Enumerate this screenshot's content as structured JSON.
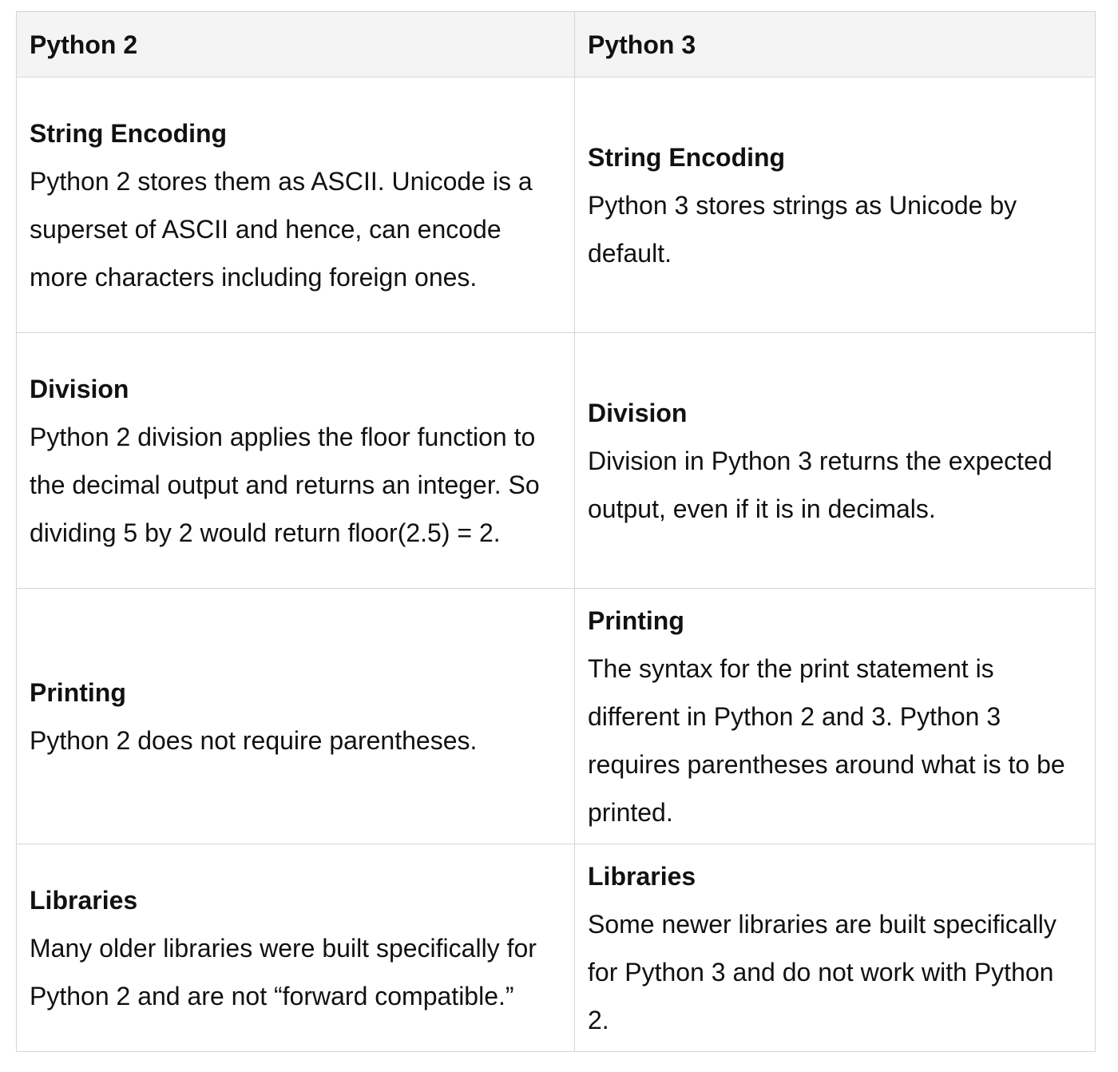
{
  "table": {
    "headers": [
      "Python 2",
      "Python 3"
    ],
    "rows": [
      {
        "python2": {
          "title": "String Encoding",
          "body": "Python 2 stores them as ASCII. Unicode is a superset of ASCII and hence, can encode more characters including foreign ones."
        },
        "python3": {
          "title": "String Encoding",
          "body": "Python 3 stores strings as Unicode by default."
        }
      },
      {
        "python2": {
          "title": "Division",
          "body": "Python 2 division applies the floor function to the decimal output and returns an integer. So dividing 5 by 2 would return floor(2.5) = 2."
        },
        "python3": {
          "title": "Division",
          "body": "Division in Python 3 returns the expected output, even if it is in decimals."
        }
      },
      {
        "python2": {
          "title": "Printing",
          "body": "Python 2 does not require parentheses."
        },
        "python3": {
          "title": "Printing",
          "body": "The syntax for the print statement is different in Python 2 and 3. Python 3 requires parentheses around what is to be printed."
        }
      },
      {
        "python2": {
          "title": "Libraries",
          "body": "Many older libraries were built specifically for Python 2 and are not “forward compatible.”"
        },
        "python3": {
          "title": "Libraries",
          "body": "Some newer libraries are built specifically for Python 3 and do not work with Python 2."
        }
      }
    ]
  }
}
